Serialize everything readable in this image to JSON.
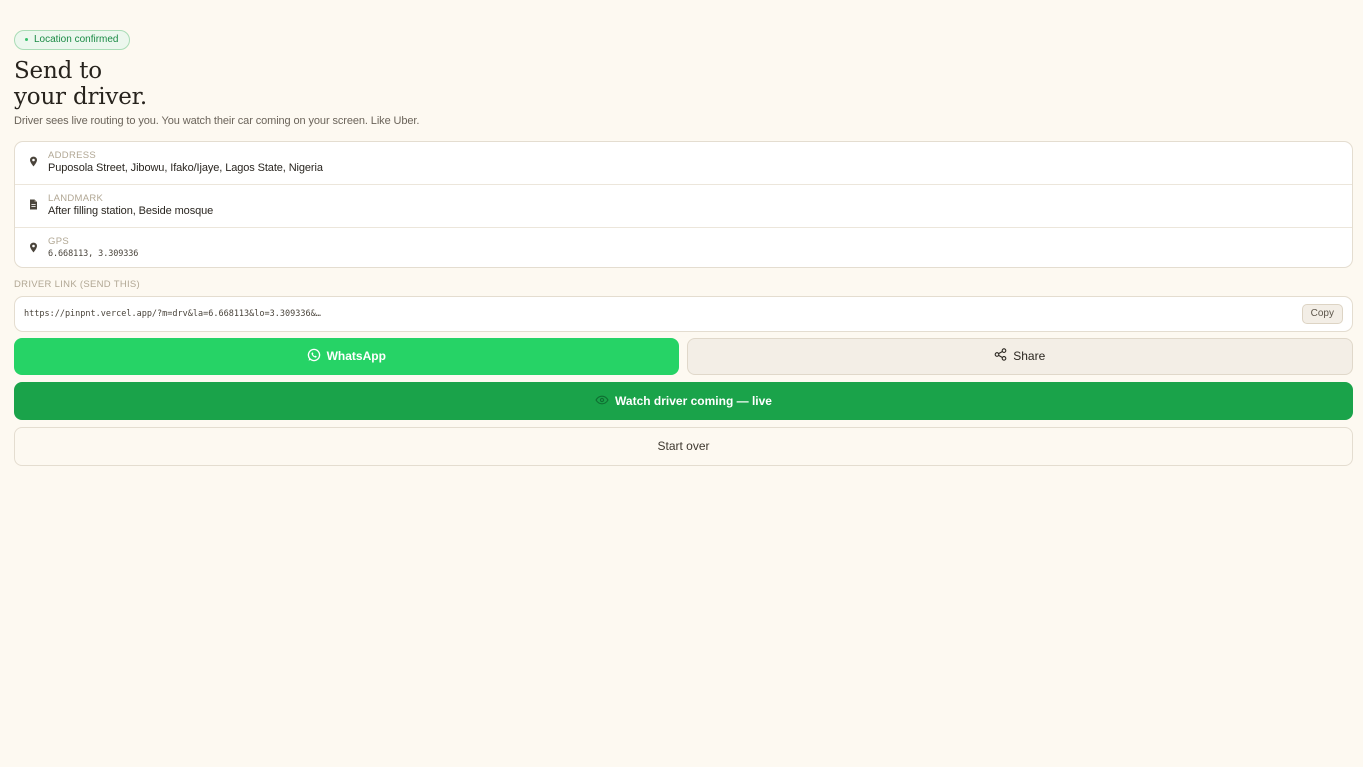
{
  "badge": {
    "text": "Location confirmed",
    "color": "#1a8a44"
  },
  "header": {
    "title_line1": "Send to",
    "title_line2": "your driver.",
    "subtitle": "Driver sees live routing to you. You watch their car coming on your screen. Like Uber."
  },
  "details": {
    "address": {
      "icon": "pin-icon",
      "label": "ADDRESS",
      "value": "Puposola Street, Jibowu, Ifako/Ijaye, Lagos State, Nigeria"
    },
    "landmark": {
      "icon": "document-icon",
      "label": "LANDMARK",
      "value": "After filling station, Beside mosque"
    },
    "gps": {
      "icon": "pin-icon",
      "label": "GPS",
      "value": "6.668113, 3.309336"
    }
  },
  "driver_link": {
    "label": "DRIVER LINK (SEND THIS)",
    "url": "https://pinpnt.vercel.app/?m=drv&la=6.668113&lo=3.309336&…",
    "copy_label": "Copy"
  },
  "actions": {
    "whatsapp_label": "WhatsApp",
    "share_label": "Share",
    "watch_label": "Watch driver coming — live",
    "start_over_label": "Start over"
  },
  "colors": {
    "background": "#fdf9f1",
    "whatsapp_green": "#26d366",
    "watch_green": "#1aa34a"
  }
}
